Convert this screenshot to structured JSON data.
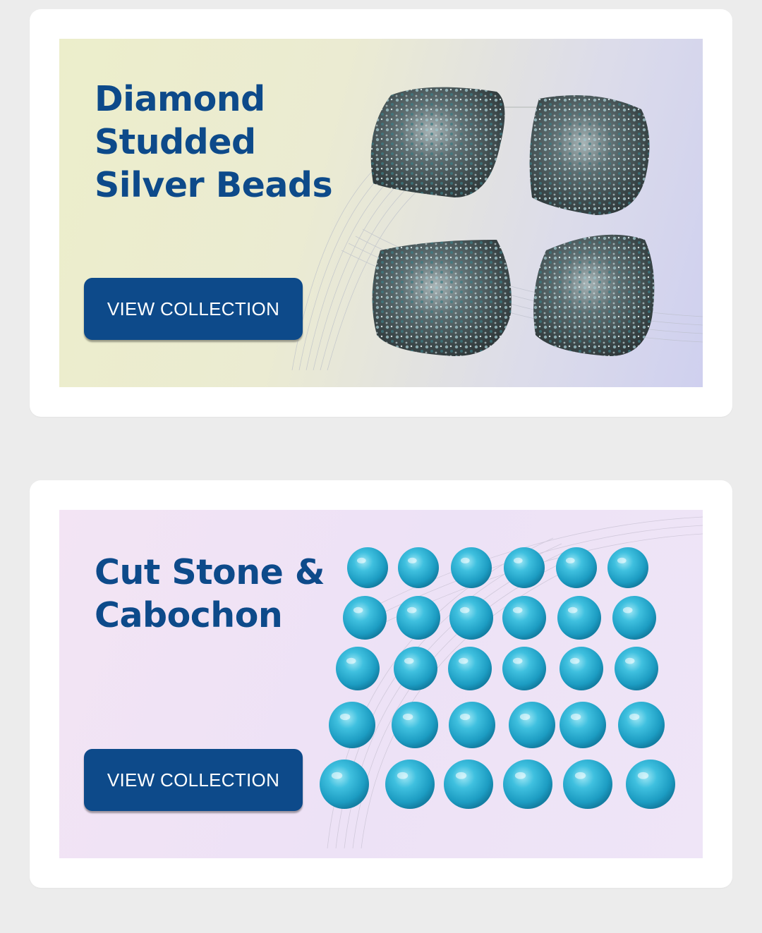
{
  "cards": [
    {
      "title_lines": [
        "Diamond",
        "Studded",
        "Silver Beads"
      ],
      "button_label": "VIEW COLLECTION",
      "image_subject": "diamond-studded-silver-beads"
    },
    {
      "title_lines": [
        "Cut Stone &",
        "Cabochon"
      ],
      "button_label": "VIEW COLLECTION",
      "image_subject": "turquoise-cabochons"
    }
  ],
  "colors": {
    "page_background": "#ececec",
    "card_background": "#ffffff",
    "accent_blue": "#0d4a8a",
    "button_text": "#ffffff",
    "turquoise": "#2fb3d6"
  }
}
